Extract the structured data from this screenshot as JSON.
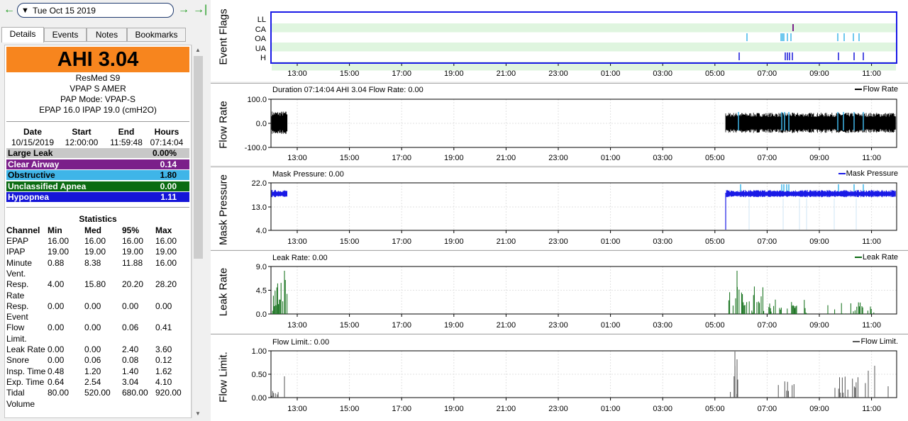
{
  "nav": {
    "date": "Tue Oct 15 2019"
  },
  "tabs": [
    "Details",
    "Events",
    "Notes",
    "Bookmarks"
  ],
  "summary": {
    "ahi": "AHI 3.04",
    "machine": "ResMed S9",
    "model": "VPAP S AMER",
    "mode": "PAP Mode: VPAP-S",
    "pressure": "EPAP 16.0 IPAP 19.0 (cmH2O)"
  },
  "session": {
    "headers": [
      "Date",
      "Start",
      "End",
      "Hours"
    ],
    "values": [
      "10/15/2019",
      "12:00:00",
      "11:59:48",
      "07:14:04"
    ]
  },
  "events": [
    {
      "label": "Large Leak",
      "value": "0.00%",
      "bg": "#c8c8c8",
      "fg": "#000000"
    },
    {
      "label": "Clear Airway",
      "value": "0.14",
      "bg": "#7b1f8a",
      "fg": "#ffffff"
    },
    {
      "label": "Obstructive",
      "value": "1.80",
      "bg": "#3fb5e8",
      "fg": "#000000"
    },
    {
      "label": "Unclassified Apnea",
      "value": "0.00",
      "bg": "#0b6b12",
      "fg": "#ffffff"
    },
    {
      "label": "Hypopnea",
      "value": "1.11",
      "bg": "#1515d8",
      "fg": "#ffffff"
    }
  ],
  "statistics": {
    "title": "Statistics",
    "headers": [
      "Channel",
      "Min",
      "Med",
      "95%",
      "Max"
    ],
    "rows": [
      {
        "lines": [
          "EPAP"
        ],
        "min": "16.00",
        "med": "16.00",
        "p95": "16.00",
        "max": "16.00"
      },
      {
        "lines": [
          "IPAP"
        ],
        "min": "19.00",
        "med": "19.00",
        "p95": "19.00",
        "max": "19.00"
      },
      {
        "lines": [
          "Minute",
          "Vent."
        ],
        "min": "0.88",
        "med": "8.38",
        "p95": "11.88",
        "max": "16.00"
      },
      {
        "lines": [
          "Resp.",
          "Rate"
        ],
        "min": "4.00",
        "med": "15.80",
        "p95": "20.20",
        "max": "28.20"
      },
      {
        "lines": [
          "Resp.",
          "Event"
        ],
        "min": "0.00",
        "med": "0.00",
        "p95": "0.00",
        "max": "0.00"
      },
      {
        "lines": [
          "Flow",
          "Limit."
        ],
        "min": "0.00",
        "med": "0.00",
        "p95": "0.06",
        "max": "0.41"
      },
      {
        "lines": [
          "Leak Rate"
        ],
        "min": "0.00",
        "med": "0.00",
        "p95": "2.40",
        "max": "3.60"
      },
      {
        "lines": [
          "Snore"
        ],
        "min": "0.00",
        "med": "0.06",
        "p95": "0.08",
        "max": "0.12"
      },
      {
        "lines": [
          "Insp. Time"
        ],
        "min": "0.48",
        "med": "1.20",
        "p95": "1.40",
        "max": "1.62"
      },
      {
        "lines": [
          "Exp. Time"
        ],
        "min": "0.64",
        "med": "2.54",
        "p95": "3.04",
        "max": "4.10"
      },
      {
        "lines": [
          "Tidal",
          "Volume"
        ],
        "min": "80.00",
        "med": "520.00",
        "p95": "680.00",
        "max": "920.00"
      }
    ]
  },
  "time_ticks": [
    "13:00",
    "15:00",
    "17:00",
    "19:00",
    "21:00",
    "23:00",
    "01:00",
    "03:00",
    "05:00",
    "07:00",
    "09:00",
    "11:00"
  ],
  "graphs": {
    "event_flags": {
      "label": "Event Flags",
      "rows": [
        "LL",
        "CA",
        "OA",
        "UA",
        "H"
      ]
    },
    "flow_rate": {
      "label": "Flow Rate",
      "title": "Duration 07:14:04 AHI 3.04 Flow Rate: 0.00",
      "legend": "Flow Rate",
      "y_ticks": [
        "100.0",
        "0.0",
        "-100.0"
      ]
    },
    "mask_pressure": {
      "label": "Mask Pressure",
      "title": "Mask Pressure: 0.00",
      "legend": "Mask Pressure",
      "y_ticks": [
        "22.0",
        "13.0",
        "4.0"
      ]
    },
    "leak_rate": {
      "label": "Leak Rate",
      "title": "Leak Rate: 0.00",
      "legend": "Leak Rate",
      "y_ticks": [
        "9.0",
        "4.5",
        "0.0"
      ]
    },
    "flow_limit": {
      "label": "Flow Limit.",
      "title": "Flow Limit.: 0.00",
      "legend": "Flow Limit.",
      "y_ticks": [
        "1.00",
        "0.50",
        "0.00"
      ]
    }
  },
  "colors": {
    "ahi_bg": "#f7851e",
    "flow": "#000000",
    "pressure": "#1a1ae6",
    "leak": "#0b6b12",
    "flowlimit": "#555555",
    "nav_arrow": "#1a9a1a"
  }
}
